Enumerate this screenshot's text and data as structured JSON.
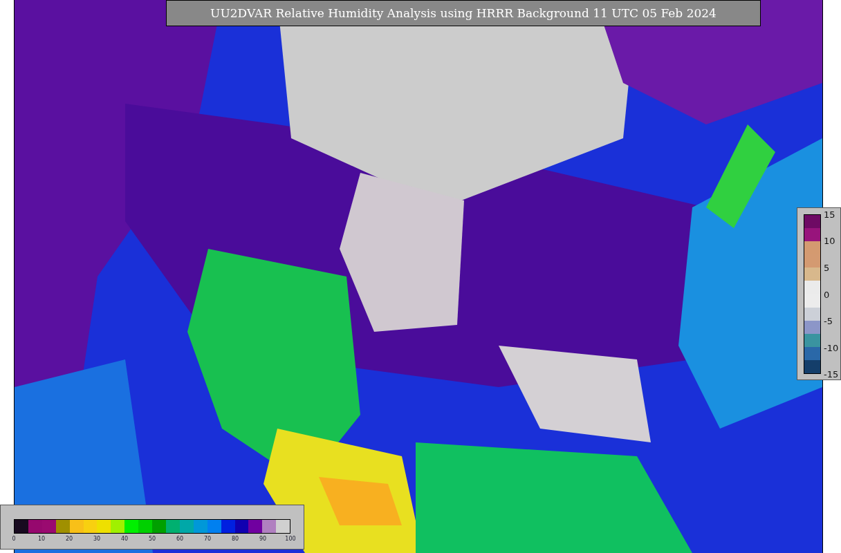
{
  "title": "UU2DVAR Relative Humidity Analysis using HRRR Background 11 UTC 05 Feb 2024",
  "humidity_colorbar": {
    "segments": [
      {
        "color": "#180a20"
      },
      {
        "color": "#96086e"
      },
      {
        "color": "#9a0a70"
      },
      {
        "color": "#a09000"
      },
      {
        "color": "#f8c018"
      },
      {
        "color": "#f8d010"
      },
      {
        "color": "#eee000"
      },
      {
        "color": "#a0f000"
      },
      {
        "color": "#00f000"
      },
      {
        "color": "#00d000"
      },
      {
        "color": "#00a000"
      },
      {
        "color": "#00b070"
      },
      {
        "color": "#00a8a8"
      },
      {
        "color": "#0098d8"
      },
      {
        "color": "#0080f0"
      },
      {
        "color": "#0020e0"
      },
      {
        "color": "#1000b0"
      },
      {
        "color": "#7000a0"
      },
      {
        "color": "#b080c0"
      },
      {
        "color": "#d0d0d0"
      }
    ],
    "ticks": [
      "0",
      "10",
      "20",
      "30",
      "40",
      "50",
      "60",
      "70",
      "80",
      "90",
      "100"
    ]
  },
  "difference_colorbar": {
    "segments": [
      {
        "color": "#6e0a64"
      },
      {
        "color": "#98147c"
      },
      {
        "color": "#d49a70"
      },
      {
        "color": "#d49a71"
      },
      {
        "color": "#d8b88c"
      },
      {
        "color": "#ebebeb"
      },
      {
        "color": "#ececec"
      },
      {
        "color": "#ccd0d8"
      },
      {
        "color": "#8c96c8"
      },
      {
        "color": "#3a94a0"
      },
      {
        "color": "#2a68a8"
      },
      {
        "color": "#143e6a"
      }
    ],
    "ticks": [
      "15",
      "10",
      "5",
      "0",
      "-5",
      "-10",
      "-15"
    ]
  }
}
